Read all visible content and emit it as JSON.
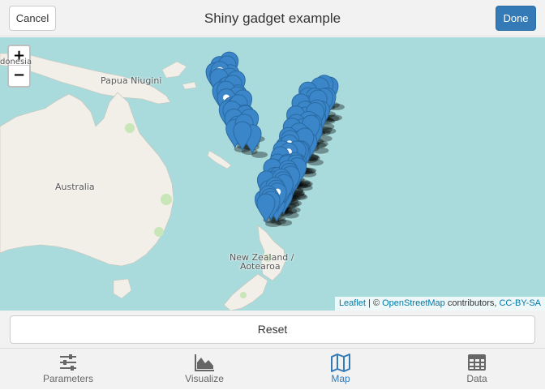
{
  "header": {
    "title": "Shiny gadget example",
    "cancel_label": "Cancel",
    "done_label": "Done"
  },
  "map": {
    "zoom_in": "+",
    "zoom_out": "−",
    "labels": {
      "papua": "Papua Niugini",
      "australia": "Australia",
      "nz_line1": "New Zealand /",
      "nz_line2": "Aotearoa",
      "cut_label": "donesia"
    },
    "attribution": {
      "leaflet": "Leaflet",
      "sep": "| ©",
      "osm": "OpenStreetMap",
      "contributors": "contributors,",
      "license": "CC-BY-SA"
    },
    "marker_color": "#3a86c8"
  },
  "reset_label": "Reset",
  "tabs": [
    {
      "label": "Parameters",
      "icon": "sliders-icon"
    },
    {
      "label": "Visualize",
      "icon": "area-chart-icon"
    },
    {
      "label": "Map",
      "icon": "map-icon"
    },
    {
      "label": "Data",
      "icon": "table-icon"
    }
  ],
  "active_tab": "Map"
}
